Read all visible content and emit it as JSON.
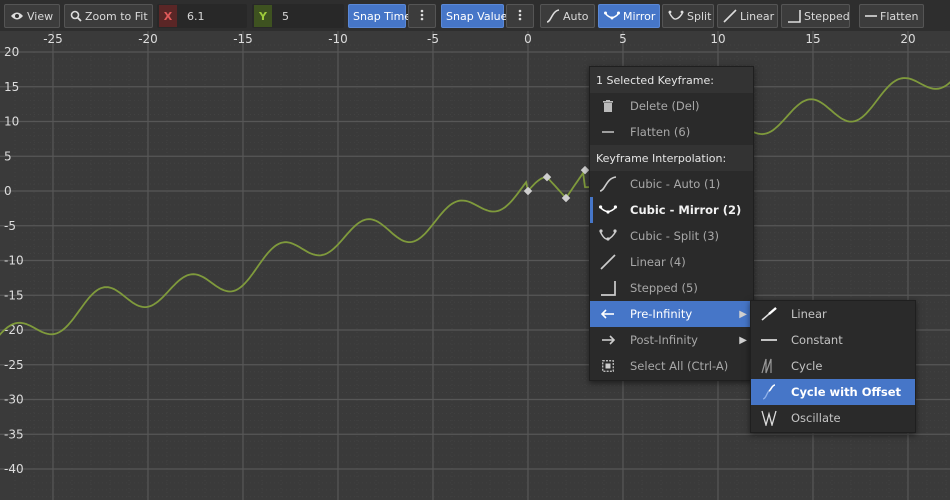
{
  "toolbar": {
    "view_label": "View",
    "zoom_to_fit_label": "Zoom to Fit",
    "x_axis_label": "X",
    "x_value": "6.1",
    "y_axis_label": "Y",
    "y_value": "5",
    "snap_time_label": "Snap Time",
    "snap_value_label": "Snap Value",
    "auto_label": "Auto",
    "mirror_label": "Mirror",
    "split_label": "Split",
    "linear_label": "Linear",
    "stepped_label": "Stepped",
    "flatten_label": "Flatten"
  },
  "graph": {
    "x_ticks": [
      "-25",
      "-20",
      "-15",
      "-10",
      "-5",
      "0",
      "5",
      "10",
      "15",
      "20"
    ],
    "y_ticks": [
      "20",
      "15",
      "10",
      "5",
      "0",
      "-5",
      "-10",
      "-15",
      "-20",
      "-25",
      "-30",
      "-35",
      "-40"
    ],
    "curve_color": "#7f9a3c",
    "keyframe_color": "#cfcfcf"
  },
  "context_menu": {
    "selection_header": "1 Selected Keyframe:",
    "delete": "Delete (Del)",
    "flatten": "Flatten (6)",
    "interp_header": "Keyframe Interpolation:",
    "cubic_auto": "Cubic - Auto (1)",
    "cubic_mirror": "Cubic - Mirror (2)",
    "cubic_split": "Cubic - Split (3)",
    "linear": "Linear (4)",
    "stepped": "Stepped (5)",
    "pre_infinity": "Pre-Infinity",
    "post_infinity": "Post-Infinity",
    "select_all": "Select All (Ctrl-A)"
  },
  "submenu": {
    "linear": "Linear",
    "constant": "Constant",
    "cycle": "Cycle",
    "cycle_with_offset": "Cycle with Offset",
    "oscillate": "Oscillate"
  },
  "colors": {
    "accent": "#4676c8",
    "x_axis": "#e05a5a",
    "y_axis": "#9ecb3a"
  }
}
